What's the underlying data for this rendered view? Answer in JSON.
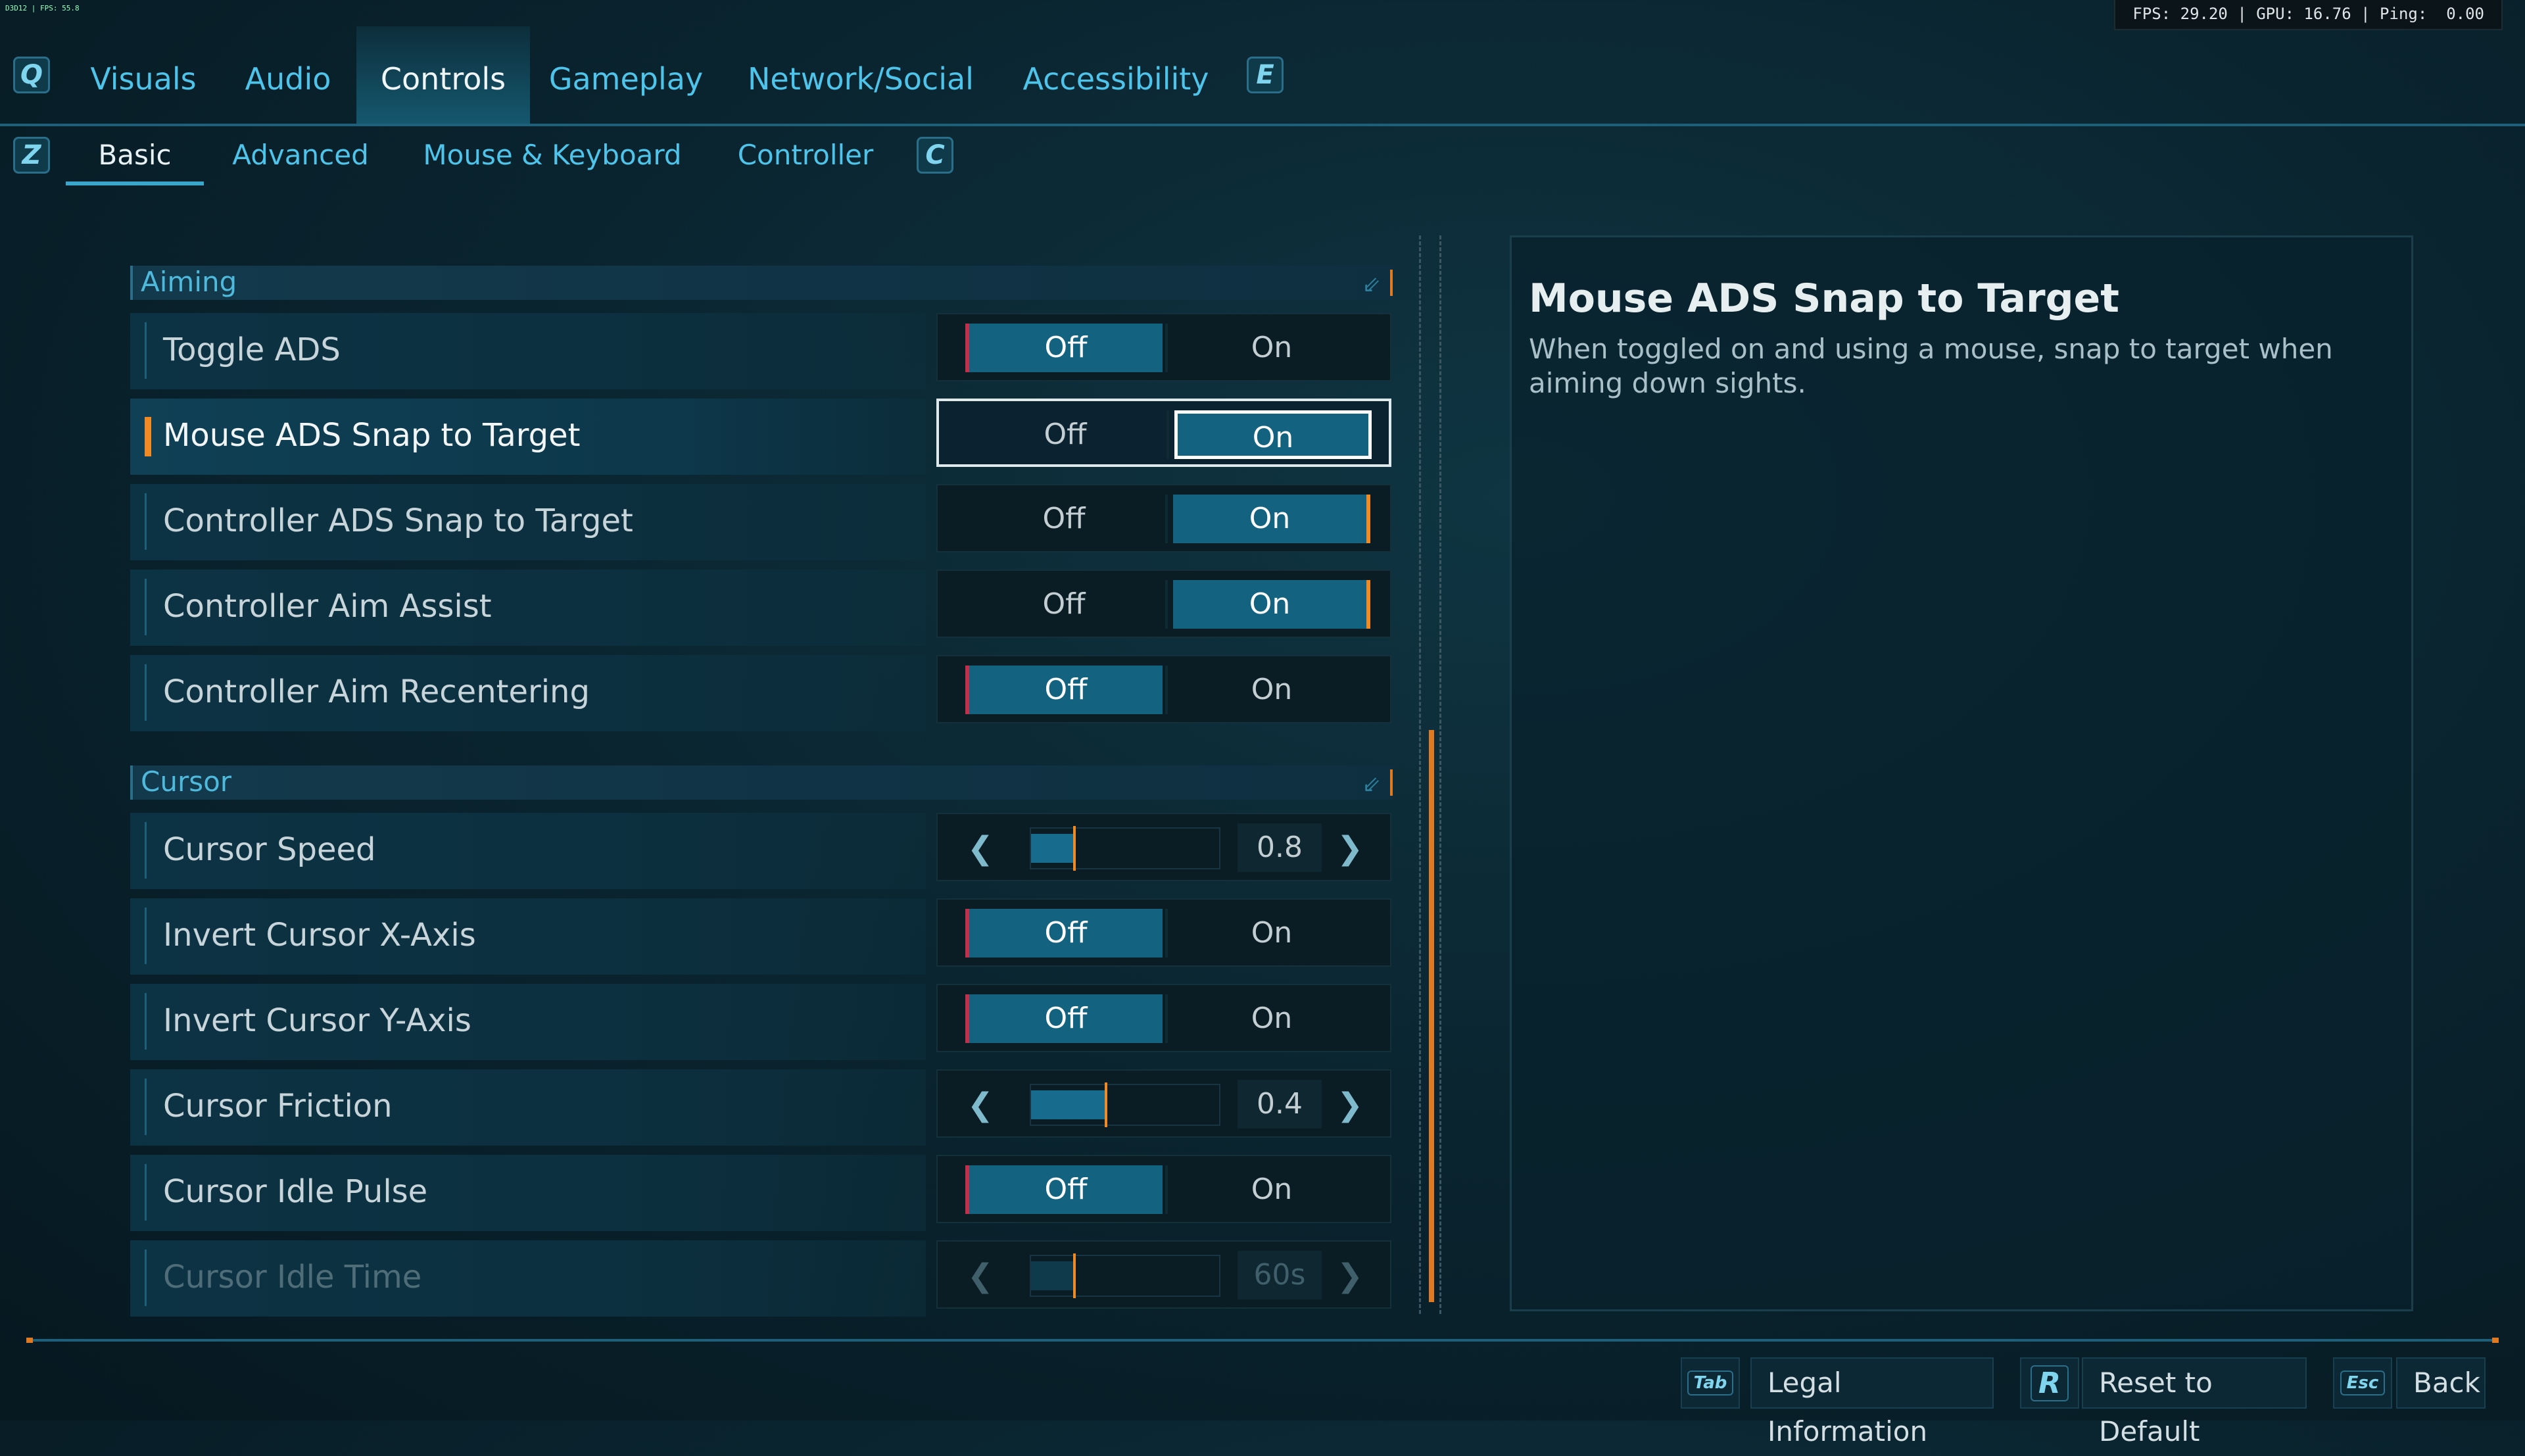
{
  "hud": {
    "tiny": "D3D12 | FPS: 55.8",
    "perf": "FPS: 29.20 | GPU: 16.76 | Ping:  0.00"
  },
  "main_tabs": {
    "left_key": "Q",
    "right_key": "E",
    "items": [
      "Visuals",
      "Audio",
      "Controls",
      "Gameplay",
      "Network/Social",
      "Accessibility"
    ],
    "active": "Controls"
  },
  "sub_tabs": {
    "left_key": "Z",
    "right_key": "C",
    "items": [
      "Basic",
      "Advanced",
      "Mouse & Keyboard",
      "Controller"
    ],
    "active": "Basic"
  },
  "sections": {
    "aiming": "Aiming",
    "cursor": "Cursor"
  },
  "toggle_labels": {
    "off": "Off",
    "on": "On"
  },
  "settings": {
    "toggle_ads": {
      "label": "Toggle ADS",
      "value": "Off"
    },
    "mouse_ads_snap": {
      "label": "Mouse ADS Snap to Target",
      "value": "On"
    },
    "controller_ads_snap": {
      "label": "Controller ADS Snap to Target",
      "value": "On"
    },
    "controller_aim_assist": {
      "label": "Controller Aim Assist",
      "value": "On"
    },
    "controller_aim_recentering": {
      "label": "Controller Aim Recentering",
      "value": "Off"
    },
    "cursor_speed": {
      "label": "Cursor Speed",
      "value": "0.8",
      "fraction": 0.23
    },
    "invert_x": {
      "label": "Invert Cursor X-Axis",
      "value": "Off"
    },
    "invert_y": {
      "label": "Invert Cursor Y-Axis",
      "value": "Off"
    },
    "cursor_friction": {
      "label": "Cursor Friction",
      "value": "0.4",
      "fraction": 0.4
    },
    "cursor_idle_pulse": {
      "label": "Cursor Idle Pulse",
      "value": "Off"
    },
    "cursor_idle_time": {
      "label": "Cursor Idle Time",
      "value": "60s",
      "fraction": 0.23
    }
  },
  "description": {
    "title": "Mouse ADS Snap to Target",
    "body": "When toggled on and using a mouse, snap to target when aiming down sights."
  },
  "footer": {
    "legal_key": "Tab",
    "legal_label": "Legal Information",
    "reset_key": "R",
    "reset_label": "Reset to Default",
    "back_key": "Esc",
    "back_label": "Back"
  },
  "colors": {
    "accent": "#4fc4ea",
    "highlight_orange": "#f08a24",
    "active_fill": "#13627f",
    "off_marker": "#c0304a"
  }
}
